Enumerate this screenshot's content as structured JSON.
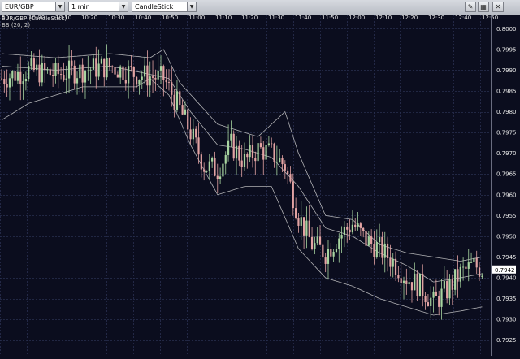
{
  "toolbar": {
    "symbol": "EUR/GBP",
    "timeframe": "1 min",
    "chart_style": "CandleStick"
  },
  "chart": {
    "title": "EUR/GBP (CandleStick)",
    "indicator": "BB (20, 2)",
    "time_labels": [
      "50",
      "10:00",
      "10:10",
      "10:20",
      "10:30",
      "10:40",
      "10:50",
      "11:00",
      "11:10",
      "11:20",
      "11:30",
      "11:40",
      "11:50",
      "12:00",
      "12:10",
      "12:20",
      "12:30",
      "12:40",
      "12:50"
    ],
    "price_labels": [
      "0.8000",
      "0.7995",
      "0.7990",
      "0.7985",
      "0.7980",
      "0.7975",
      "0.7970",
      "0.7965",
      "0.7960",
      "0.7955",
      "0.7950",
      "0.7945",
      "0.7940",
      "0.7935",
      "0.7930",
      "0.7925"
    ],
    "current_price": "0.7942",
    "colors": {
      "background": "#0b0d1e",
      "grid": "#2a3050",
      "up_candle": "#a8d5a0",
      "down_candle": "#e3a3a3",
      "bands": "#cfcfcf",
      "price_line": "#ffffff"
    }
  },
  "chart_data": {
    "type": "candlestick",
    "symbol": "EUR/GBP",
    "y_range": [
      0.7922,
      0.8003
    ],
    "close": [
      [
        0,
        0.7988
      ],
      [
        10,
        0.799
      ],
      [
        20,
        0.7989
      ],
      [
        30,
        0.799
      ],
      [
        40,
        0.7991
      ],
      [
        50,
        0.7989
      ],
      [
        60,
        0.7988
      ],
      [
        65,
        0.7982
      ],
      [
        70,
        0.7975
      ],
      [
        75,
        0.7967
      ],
      [
        80,
        0.7966
      ],
      [
        85,
        0.7972
      ],
      [
        90,
        0.7968
      ],
      [
        95,
        0.7971
      ],
      [
        100,
        0.797
      ],
      [
        105,
        0.7967
      ],
      [
        110,
        0.7955
      ],
      [
        115,
        0.7948
      ],
      [
        120,
        0.7946
      ],
      [
        125,
        0.795
      ],
      [
        130,
        0.7953
      ],
      [
        135,
        0.7949
      ],
      [
        140,
        0.7947
      ],
      [
        145,
        0.7944
      ],
      [
        150,
        0.794
      ],
      [
        155,
        0.7938
      ],
      [
        160,
        0.7934
      ],
      [
        165,
        0.7937
      ],
      [
        170,
        0.7941
      ],
      [
        175,
        0.7943
      ],
      [
        178,
        0.7942
      ]
    ],
    "bollinger": {
      "period": 20,
      "deviations": 2,
      "upper": [
        [
          0,
          0.7994
        ],
        [
          20,
          0.7993
        ],
        [
          40,
          0.7994
        ],
        [
          55,
          0.7993
        ],
        [
          60,
          0.7995
        ],
        [
          66,
          0.7987
        ],
        [
          80,
          0.7977
        ],
        [
          95,
          0.7974
        ],
        [
          105,
          0.798
        ],
        [
          110,
          0.797
        ],
        [
          120,
          0.7955
        ],
        [
          130,
          0.7954
        ],
        [
          140,
          0.7948
        ],
        [
          150,
          0.7946
        ],
        [
          160,
          0.7945
        ],
        [
          170,
          0.7944
        ],
        [
          178,
          0.7945
        ]
      ],
      "middle": [
        [
          0,
          0.7991
        ],
        [
          20,
          0.799
        ],
        [
          40,
          0.7991
        ],
        [
          55,
          0.7989
        ],
        [
          62,
          0.7988
        ],
        [
          70,
          0.798
        ],
        [
          80,
          0.7972
        ],
        [
          90,
          0.7971
        ],
        [
          100,
          0.7969
        ],
        [
          110,
          0.7962
        ],
        [
          120,
          0.7952
        ],
        [
          130,
          0.795
        ],
        [
          140,
          0.7946
        ],
        [
          150,
          0.7943
        ],
        [
          160,
          0.7939
        ],
        [
          170,
          0.794
        ],
        [
          178,
          0.7941
        ]
      ],
      "lower": [
        [
          0,
          0.7978
        ],
        [
          10,
          0.7982
        ],
        [
          30,
          0.7986
        ],
        [
          50,
          0.7986
        ],
        [
          55,
          0.7988
        ],
        [
          62,
          0.7984
        ],
        [
          70,
          0.7972
        ],
        [
          80,
          0.796
        ],
        [
          90,
          0.7962
        ],
        [
          100,
          0.7962
        ],
        [
          110,
          0.7947
        ],
        [
          120,
          0.794
        ],
        [
          130,
          0.7938
        ],
        [
          140,
          0.7935
        ],
        [
          150,
          0.7933
        ],
        [
          160,
          0.7931
        ],
        [
          170,
          0.7932
        ],
        [
          178,
          0.7933
        ]
      ]
    },
    "current_price": 0.7942,
    "grid": true
  }
}
